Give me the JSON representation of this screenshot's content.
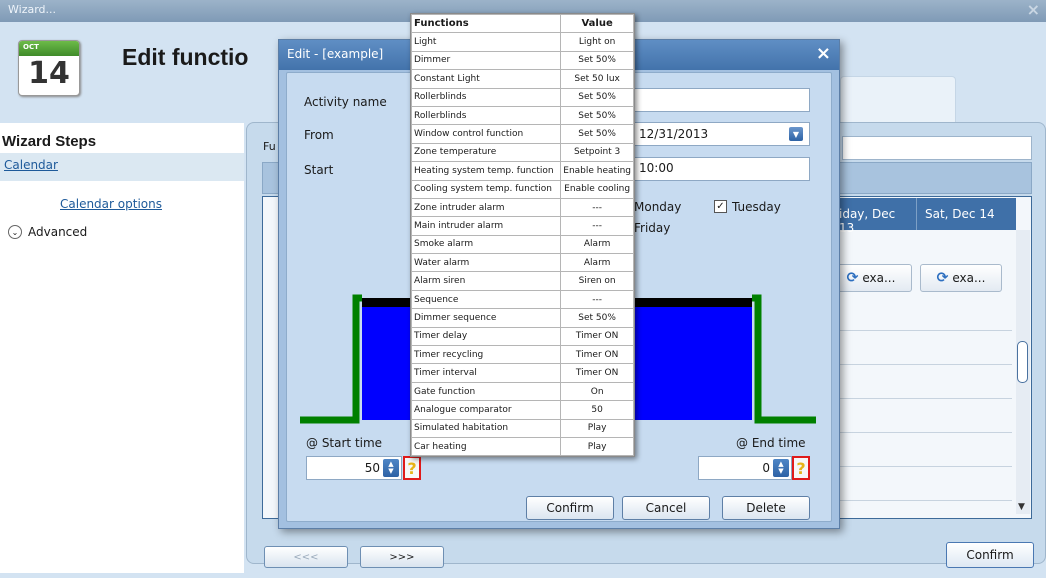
{
  "window": {
    "title": "Wizard..."
  },
  "calendar_icon": {
    "month": "OCT",
    "day": "14"
  },
  "page": {
    "title": "Edit functio"
  },
  "sidebar": {
    "heading": "Wizard Steps",
    "items": [
      "Calendar",
      "Calendar options",
      "Advanced"
    ]
  },
  "main": {
    "label_fu": "Fu"
  },
  "grid": {
    "headers": [
      "iday, Dec 13",
      "Sat, Dec 14"
    ],
    "events": [
      "exa...",
      "exa..."
    ]
  },
  "nav": {
    "prev": "<<<",
    "next": ">>>",
    "confirm": "Confirm"
  },
  "dialog": {
    "title": "Edit - [example]",
    "activity_label": "Activity name",
    "from_label": "From",
    "start_label": "Start",
    "date_value": "12/31/2013",
    "time_value": "10:00",
    "monday": "Monday",
    "friday": "Friday",
    "tuesday": "Tuesday",
    "start_time_label": "@ Start time",
    "end_time_label": "@ End time",
    "start_time_value": "50",
    "end_time_value": "0",
    "confirm": "Confirm",
    "cancel": "Cancel",
    "delete": "Delete"
  },
  "functions_table": {
    "headers": [
      "Functions",
      "Value"
    ],
    "rows": [
      [
        "Light",
        "Light on"
      ],
      [
        "Dimmer",
        "Set 50%"
      ],
      [
        "Constant Light",
        "Set 50 lux"
      ],
      [
        "Rollerblinds",
        "Set 50%"
      ],
      [
        "Rollerblinds",
        "Set 50%"
      ],
      [
        "Window control function",
        "Set 50%"
      ],
      [
        "Zone temperature",
        "Setpoint 3"
      ],
      [
        "Heating system temp. function",
        "Enable heating"
      ],
      [
        "Cooling system temp. function",
        "Enable cooling"
      ],
      [
        "Zone intruder alarm",
        "---"
      ],
      [
        "Main intruder alarm",
        "---"
      ],
      [
        "Smoke alarm",
        "Alarm"
      ],
      [
        "Water alarm",
        "Alarm"
      ],
      [
        "Alarm siren",
        "Siren on"
      ],
      [
        "Sequence",
        "---"
      ],
      [
        "Dimmer sequence",
        "Set 50%"
      ],
      [
        "Timer delay",
        "Timer ON"
      ],
      [
        "Timer recycling",
        "Timer ON"
      ],
      [
        "Timer interval",
        "Timer ON"
      ],
      [
        "Gate function",
        "On"
      ],
      [
        "Analogue comparator",
        "50"
      ],
      [
        "Simulated habitation",
        "Play"
      ],
      [
        "Car heating",
        "Play"
      ]
    ]
  }
}
